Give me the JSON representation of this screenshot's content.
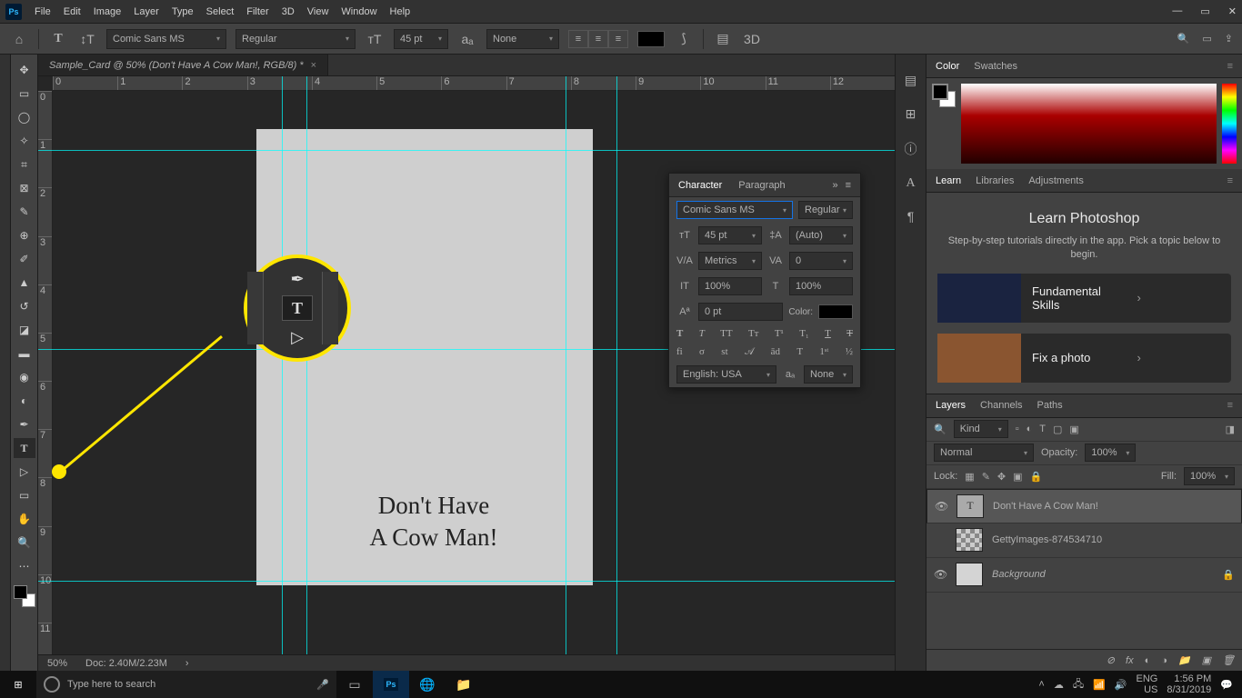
{
  "menu": [
    "File",
    "Edit",
    "Image",
    "Layer",
    "Type",
    "Select",
    "Filter",
    "3D",
    "View",
    "Window",
    "Help"
  ],
  "options": {
    "font": "Comic Sans MS",
    "style": "Regular",
    "size": "45 pt",
    "aa": "None"
  },
  "doc_tab": "Sample_Card @ 50% (Don't Have A Cow Man!, RGB/8) *",
  "ruler_h": [
    "0",
    "1",
    "2",
    "3",
    "4",
    "5",
    "6",
    "7",
    "8",
    "9",
    "10",
    "11",
    "12"
  ],
  "ruler_v": [
    "0",
    "1",
    "2",
    "3",
    "4",
    "5",
    "6",
    "7",
    "8",
    "9",
    "10",
    "11"
  ],
  "canvas_text": "Don't Have\nA Cow Man!",
  "status": {
    "zoom": "50%",
    "doc": "Doc: 2.40M/2.23M"
  },
  "char": {
    "tab1": "Character",
    "tab2": "Paragraph",
    "font": "Comic Sans MS",
    "style": "Regular",
    "size": "45 pt",
    "leading": "(Auto)",
    "kerning": "Metrics",
    "tracking": "0",
    "vscale": "100%",
    "hscale": "100%",
    "baseline": "0 pt",
    "color_label": "Color:",
    "lang": "English: USA",
    "aa": "None"
  },
  "panels": {
    "color_tabs": [
      "Color",
      "Swatches"
    ],
    "learn_tabs": [
      "Learn",
      "Libraries",
      "Adjustments"
    ],
    "learn_title": "Learn Photoshop",
    "learn_sub": "Step-by-step tutorials directly in the app. Pick a topic below to begin.",
    "learn_cards": [
      "Fundamental Skills",
      "Fix a photo"
    ],
    "layer_tabs": [
      "Layers",
      "Channels",
      "Paths"
    ],
    "filter": "Kind",
    "blend": "Normal",
    "opacity_label": "Opacity:",
    "opacity": "100%",
    "lock_label": "Lock:",
    "fill_label": "Fill:",
    "fill": "100%",
    "layers": [
      {
        "name": "Don't Have A Cow Man!",
        "type": "T",
        "vis": true,
        "sel": true
      },
      {
        "name": "GettyImages-874534710",
        "type": "img",
        "vis": false,
        "sel": false
      },
      {
        "name": "Background",
        "type": "bg",
        "vis": true,
        "sel": false,
        "locked": true
      }
    ]
  },
  "taskbar": {
    "search": "Type here to search",
    "lang": "ENG",
    "kbd": "US",
    "time": "1:56 PM",
    "date": "8/31/2019"
  }
}
